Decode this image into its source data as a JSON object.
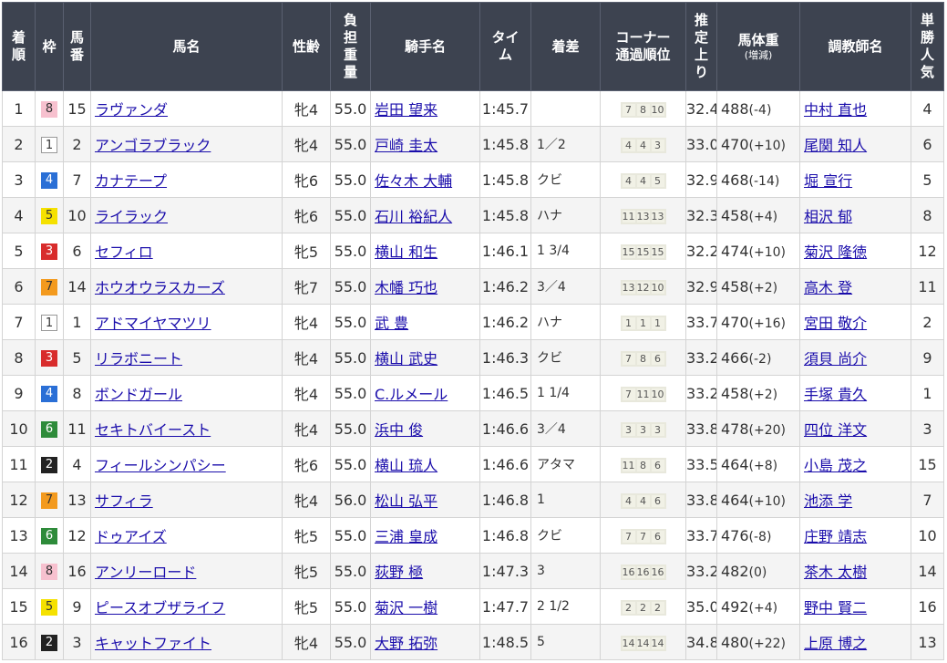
{
  "headers": {
    "rank": "着順",
    "waku": "枠",
    "umaban": "馬番",
    "name": "馬名",
    "sexage": "性齢",
    "weight": "負担重量",
    "jockey": "騎手名",
    "time": "タイム",
    "margin": "着差",
    "corner": "コーナー通過順位",
    "last3f": "推定上り",
    "bodyweight": "馬体重",
    "bodyweight_sub": "(増減)",
    "trainer": "調教師名",
    "popularity": "単勝人気"
  },
  "rows": [
    {
      "rank": "1",
      "waku": "8",
      "umaban": "15",
      "name": "ラヴァンダ",
      "sexage": "牝4",
      "weight": "55.0",
      "jockey": "岩田 望来",
      "time": "1:45.7",
      "margin": "",
      "corner": [
        "7",
        "8",
        "10"
      ],
      "last3f": "32.4",
      "bw": "488",
      "bwdiff": "(-4)",
      "trainer": "中村 直也",
      "pop": "4"
    },
    {
      "rank": "2",
      "waku": "1",
      "umaban": "2",
      "name": "アンゴラブラック",
      "sexage": "牝4",
      "weight": "55.0",
      "jockey": "戸崎 圭太",
      "time": "1:45.8",
      "margin": "1／2",
      "corner": [
        "4",
        "4",
        "3"
      ],
      "last3f": "33.0",
      "bw": "470",
      "bwdiff": "(+10)",
      "trainer": "尾関 知人",
      "pop": "6"
    },
    {
      "rank": "3",
      "waku": "4",
      "umaban": "7",
      "name": "カナテープ",
      "sexage": "牝6",
      "weight": "55.0",
      "jockey": "佐々木 大輔",
      "time": "1:45.8",
      "margin": "クビ",
      "corner": [
        "4",
        "4",
        "5"
      ],
      "last3f": "32.9",
      "bw": "468",
      "bwdiff": "(-14)",
      "trainer": "堀 宣行",
      "pop": "5"
    },
    {
      "rank": "4",
      "waku": "5",
      "umaban": "10",
      "name": "ライラック",
      "sexage": "牝6",
      "weight": "55.0",
      "jockey": "石川 裕紀人",
      "time": "1:45.8",
      "margin": "ハナ",
      "corner": [
        "11",
        "13",
        "13"
      ],
      "last3f": "32.3",
      "bw": "458",
      "bwdiff": "(+4)",
      "trainer": "相沢 郁",
      "pop": "8"
    },
    {
      "rank": "5",
      "waku": "3",
      "umaban": "6",
      "name": "セフィロ",
      "sexage": "牝5",
      "weight": "55.0",
      "jockey": "横山 和生",
      "time": "1:46.1",
      "margin": "1 3/4",
      "corner": [
        "15",
        "15",
        "15"
      ],
      "last3f": "32.2",
      "bw": "474",
      "bwdiff": "(+10)",
      "trainer": "菊沢 隆徳",
      "pop": "12"
    },
    {
      "rank": "6",
      "waku": "7",
      "umaban": "14",
      "name": "ホウオウラスカーズ",
      "sexage": "牝7",
      "weight": "55.0",
      "jockey": "木幡 巧也",
      "time": "1:46.2",
      "margin": "3／4",
      "corner": [
        "13",
        "12",
        "10"
      ],
      "last3f": "32.9",
      "bw": "458",
      "bwdiff": "(+2)",
      "trainer": "高木 登",
      "pop": "11"
    },
    {
      "rank": "7",
      "waku": "1",
      "umaban": "1",
      "name": "アドマイヤマツリ",
      "sexage": "牝4",
      "weight": "55.0",
      "jockey": "武 豊",
      "time": "1:46.2",
      "margin": "ハナ",
      "corner": [
        "1",
        "1",
        "1"
      ],
      "last3f": "33.7",
      "bw": "470",
      "bwdiff": "(+16)",
      "trainer": "宮田 敬介",
      "pop": "2"
    },
    {
      "rank": "8",
      "waku": "3",
      "umaban": "5",
      "name": "リラボニート",
      "sexage": "牝4",
      "weight": "55.0",
      "jockey": "横山 武史",
      "time": "1:46.3",
      "margin": "クビ",
      "corner": [
        "7",
        "8",
        "6"
      ],
      "last3f": "33.2",
      "bw": "466",
      "bwdiff": "(-2)",
      "trainer": "須貝 尚介",
      "pop": "9"
    },
    {
      "rank": "9",
      "waku": "4",
      "umaban": "8",
      "name": "ボンドガール",
      "sexage": "牝4",
      "weight": "55.0",
      "jockey": "C.ルメール",
      "time": "1:46.5",
      "margin": "1 1/4",
      "corner": [
        "7",
        "11",
        "10"
      ],
      "last3f": "33.2",
      "bw": "458",
      "bwdiff": "(+2)",
      "trainer": "手塚 貴久",
      "pop": "1"
    },
    {
      "rank": "10",
      "waku": "6",
      "umaban": "11",
      "name": "セキトバイースト",
      "sexage": "牝4",
      "weight": "55.0",
      "jockey": "浜中 俊",
      "time": "1:46.6",
      "margin": "3／4",
      "corner": [
        "3",
        "3",
        "3"
      ],
      "last3f": "33.8",
      "bw": "478",
      "bwdiff": "(+20)",
      "trainer": "四位 洋文",
      "pop": "3"
    },
    {
      "rank": "11",
      "waku": "2",
      "umaban": "4",
      "name": "フィールシンパシー",
      "sexage": "牝6",
      "weight": "55.0",
      "jockey": "横山 琉人",
      "time": "1:46.6",
      "margin": "アタマ",
      "corner": [
        "11",
        "8",
        "6"
      ],
      "last3f": "33.5",
      "bw": "464",
      "bwdiff": "(+8)",
      "trainer": "小島 茂之",
      "pop": "15"
    },
    {
      "rank": "12",
      "waku": "7",
      "umaban": "13",
      "name": "サフィラ",
      "sexage": "牝4",
      "weight": "56.0",
      "jockey": "松山 弘平",
      "time": "1:46.8",
      "margin": "1",
      "corner": [
        "4",
        "4",
        "6"
      ],
      "last3f": "33.8",
      "bw": "464",
      "bwdiff": "(+10)",
      "trainer": "池添 学",
      "pop": "7"
    },
    {
      "rank": "13",
      "waku": "6",
      "umaban": "12",
      "name": "ドゥアイズ",
      "sexage": "牝5",
      "weight": "55.0",
      "jockey": "三浦 皇成",
      "time": "1:46.8",
      "margin": "クビ",
      "corner": [
        "7",
        "7",
        "6"
      ],
      "last3f": "33.7",
      "bw": "476",
      "bwdiff": "(-8)",
      "trainer": "庄野 靖志",
      "pop": "10"
    },
    {
      "rank": "14",
      "waku": "8",
      "umaban": "16",
      "name": "アンリーロード",
      "sexage": "牝5",
      "weight": "55.0",
      "jockey": "荻野 極",
      "time": "1:47.3",
      "margin": "3",
      "corner": [
        "16",
        "16",
        "16"
      ],
      "last3f": "33.2",
      "bw": "482",
      "bwdiff": "(0)",
      "trainer": "茶木 太樹",
      "pop": "14"
    },
    {
      "rank": "15",
      "waku": "5",
      "umaban": "9",
      "name": "ピースオブザライフ",
      "sexage": "牝5",
      "weight": "55.0",
      "jockey": "菊沢 一樹",
      "time": "1:47.7",
      "margin": "2 1/2",
      "corner": [
        "2",
        "2",
        "2"
      ],
      "last3f": "35.0",
      "bw": "492",
      "bwdiff": "(+4)",
      "trainer": "野中 賢二",
      "pop": "16"
    },
    {
      "rank": "16",
      "waku": "2",
      "umaban": "3",
      "name": "キャットファイト",
      "sexage": "牝4",
      "weight": "55.0",
      "jockey": "大野 拓弥",
      "time": "1:48.5",
      "margin": "5",
      "corner": [
        "14",
        "14",
        "14"
      ],
      "last3f": "34.8",
      "bw": "480",
      "bwdiff": "(+22)",
      "trainer": "上原 博之",
      "pop": "13"
    }
  ]
}
